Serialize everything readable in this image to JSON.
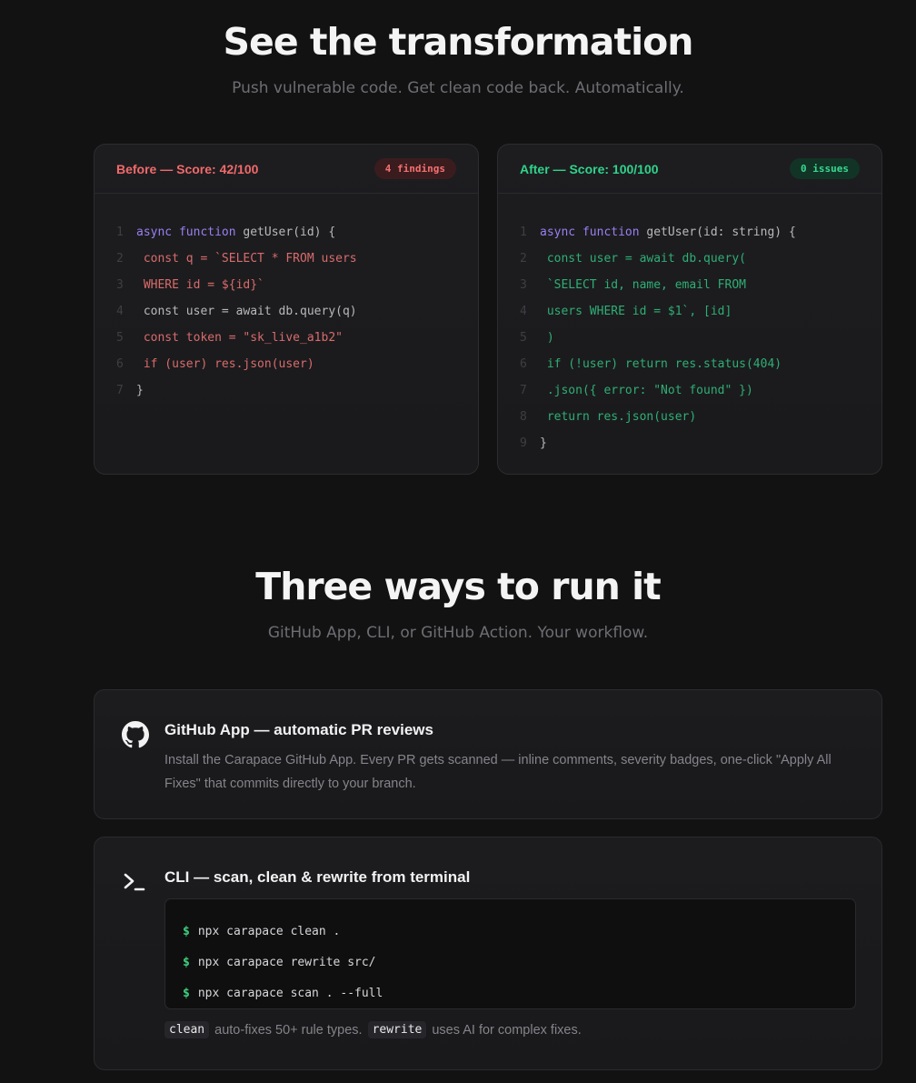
{
  "transformation": {
    "title": "See the transformation",
    "subtitle": "Push vulnerable code. Get clean code back. Automatically.",
    "before": {
      "title": "Before — Score: 42/100",
      "badge": "4 findings",
      "lines": [
        {
          "num": "1",
          "kw": "async function",
          "text": " getUser(id) {"
        },
        {
          "num": "2",
          "kw": "",
          "text": " const q = `SELECT * FROM users"
        },
        {
          "num": "3",
          "kw": "",
          "text": " WHERE id = ${id}`"
        },
        {
          "num": "4",
          "kw": "",
          "text": " const user = await db.query(q)"
        },
        {
          "num": "5",
          "kw": "",
          "text": " const token = \"sk_live_a1b2\""
        },
        {
          "num": "6",
          "kw": "",
          "text": " if (user) res.json(user)"
        },
        {
          "num": "7",
          "kw": "",
          "text": "}"
        }
      ]
    },
    "after": {
      "title": "After — Score: 100/100",
      "badge": "0 issues",
      "lines": [
        {
          "num": "1",
          "kw": "async function",
          "text": " getUser(id: string) {"
        },
        {
          "num": "2",
          "kw": "",
          "text": " const user = await db.query("
        },
        {
          "num": "3",
          "kw": "",
          "text": " `SELECT id, name, email FROM"
        },
        {
          "num": "4",
          "kw": "",
          "text": " users WHERE id = $1`, [id]"
        },
        {
          "num": "5",
          "kw": "",
          "text": " )"
        },
        {
          "num": "6",
          "kw": "",
          "text": " if (!user) return res.status(404)"
        },
        {
          "num": "7",
          "kw": "",
          "text": " .json({ error: \"Not found\" })"
        },
        {
          "num": "8",
          "kw": "",
          "text": " return res.json(user)"
        },
        {
          "num": "9",
          "kw": "",
          "text": "}"
        }
      ]
    }
  },
  "ways": {
    "title": "Three ways to run it",
    "subtitle": "GitHub App, CLI, or GitHub Action. Your workflow.",
    "github": {
      "icon": "github-icon",
      "title": "GitHub App — automatic PR reviews",
      "description": "Install the Carapace GitHub App. Every PR gets scanned — inline comments, severity badges, one-click \"Apply All Fixes\" that commits directly to your branch."
    },
    "cli": {
      "icon": "terminal-icon",
      "title": "CLI — scan, clean & rewrite from terminal",
      "prompt": "$",
      "commands": [
        "npx carapace clean .",
        "npx carapace rewrite src/",
        "npx carapace scan . --full"
      ],
      "note": {
        "code1": "clean",
        "text1": "auto-fixes 50+ rule types.",
        "code2": "rewrite",
        "text2": "uses AI for complex fixes."
      }
    }
  },
  "colors": {
    "before_accent": "#f26a6a",
    "after_accent": "#2fd48a",
    "keyword": "#9a7ff0",
    "prompt": "#3fcf7c"
  }
}
